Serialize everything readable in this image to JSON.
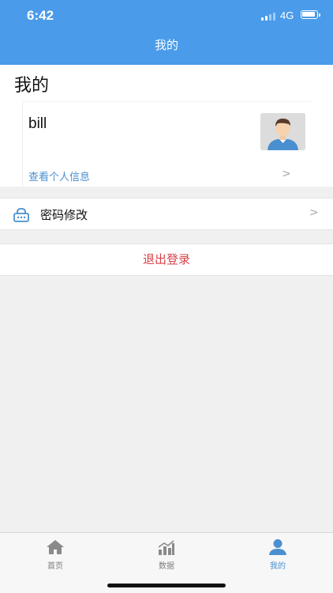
{
  "status": {
    "time": "6:42",
    "network": "4G"
  },
  "nav": {
    "title": "我的"
  },
  "page": {
    "heading": "我的"
  },
  "profile": {
    "username": "bill",
    "view_info": "查看个人信息"
  },
  "menu": {
    "change_password": "密码修改",
    "logout": "退出登录"
  },
  "tabs": [
    {
      "label": "首页",
      "icon": "home-icon",
      "active": false
    },
    {
      "label": "数据",
      "icon": "chart-icon",
      "active": false
    },
    {
      "label": "我的",
      "icon": "person-icon",
      "active": true
    }
  ],
  "colors": {
    "primary": "#4a9bea",
    "link": "#4a8fd0",
    "danger": "#d9404a",
    "background": "#f0f0f0"
  }
}
